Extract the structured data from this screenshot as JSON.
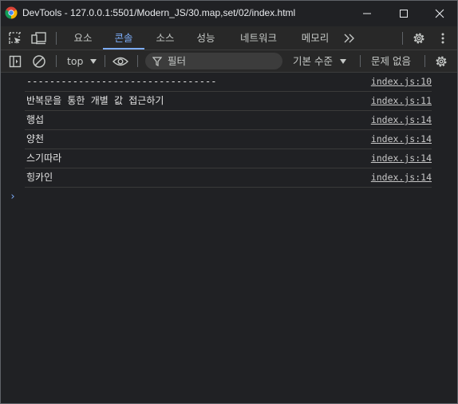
{
  "window": {
    "title": "DevTools - 127.0.0.1:5501/Modern_JS/30.map,set/02/index.html"
  },
  "tabs": [
    {
      "label": "요소"
    },
    {
      "label": "콘솔",
      "active": true
    },
    {
      "label": "소스"
    },
    {
      "label": "성능"
    },
    {
      "label": "네트워크"
    },
    {
      "label": "메모리"
    }
  ],
  "console_toolbar": {
    "context": "top",
    "filter_placeholder": "필터",
    "levels": "기본 수준",
    "issues": "문제 없음"
  },
  "log": [
    {
      "message": "---------------------------------",
      "source": "index.js:10"
    },
    {
      "message": "반복문을 통한 개별 값 접근하기",
      "source": "index.js:11"
    },
    {
      "message": "행섭",
      "source": "index.js:14"
    },
    {
      "message": "양천",
      "source": "index.js:14"
    },
    {
      "message": "스기따라",
      "source": "index.js:14"
    },
    {
      "message": "힝카인",
      "source": "index.js:14"
    }
  ],
  "prompt": "›",
  "icons": {
    "app": "chrome-logo-icon",
    "minimize": "minimize-icon",
    "maximize": "maximize-icon",
    "close": "close-icon",
    "inspect": "inspect-element-icon",
    "device": "device-toolbar-icon",
    "more_tabs": "chevron-double-right-icon",
    "settings": "gear-icon",
    "menu": "kebab-menu-icon",
    "sidebar": "sidebar-toggle-icon",
    "clear": "clear-console-icon",
    "dropdown": "caret-down-icon",
    "live_expression": "eye-icon",
    "filter": "filter-icon",
    "console_settings": "gear-icon"
  },
  "colors": {
    "background": "#202124",
    "accent": "#7cacf8"
  }
}
